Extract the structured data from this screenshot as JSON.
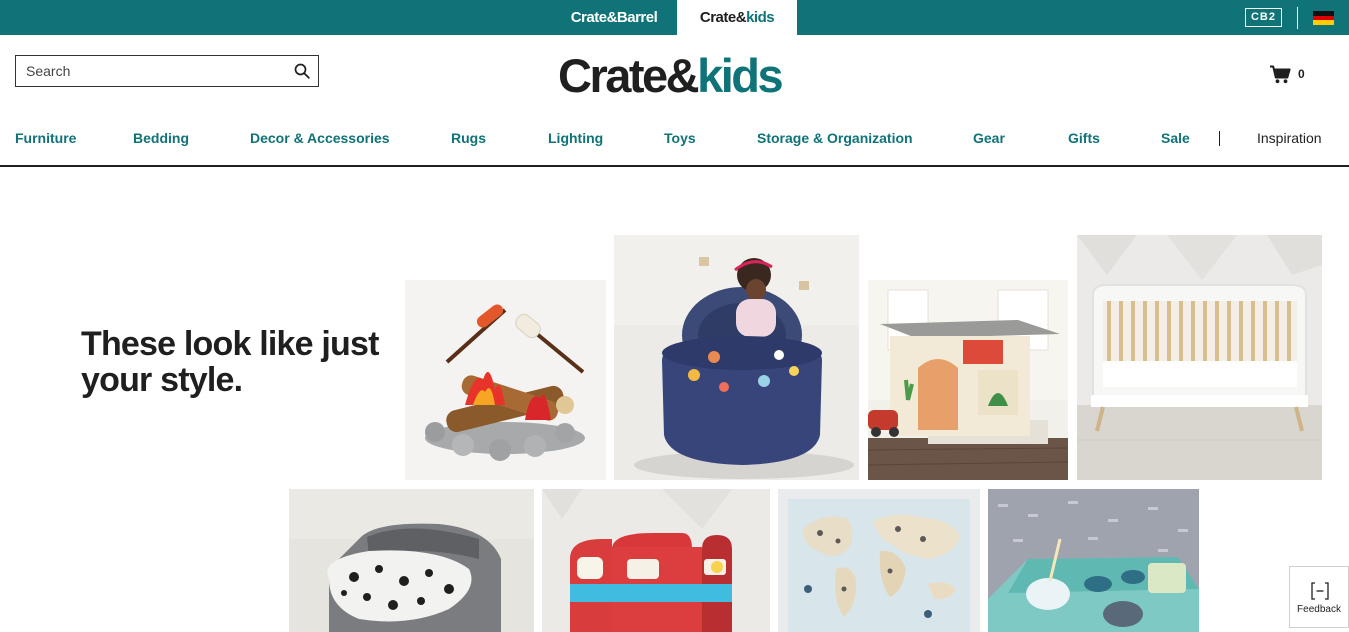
{
  "topbar": {
    "brand_crate_barrel": "Crate&Barrel",
    "brand_kids_part1": "Crate&",
    "brand_kids_part2": "kids",
    "cb2": "CB2",
    "flag_icon": "germany-flag-icon",
    "color": "#0f7377"
  },
  "header": {
    "search_placeholder": "Search",
    "logo_part1": "Crate&",
    "logo_part2": "kids",
    "cart_count": "0",
    "cart_icon": "shopping-cart-icon",
    "search_icon": "magnifier-icon"
  },
  "nav": {
    "items": [
      "Furniture",
      "Bedding",
      "Decor & Accessories",
      "Rugs",
      "Lighting",
      "Toys",
      "Storage & Organization",
      "Gear",
      "Gifts",
      "Sale"
    ],
    "inspiration": "Inspiration"
  },
  "hero": {
    "headline": "These look like just your style."
  },
  "feedback": {
    "label": "Feedback",
    "icon": "feedback-bracket-icon"
  },
  "colors": {
    "accent": "#0f7377",
    "text": "#1f1f1f"
  }
}
